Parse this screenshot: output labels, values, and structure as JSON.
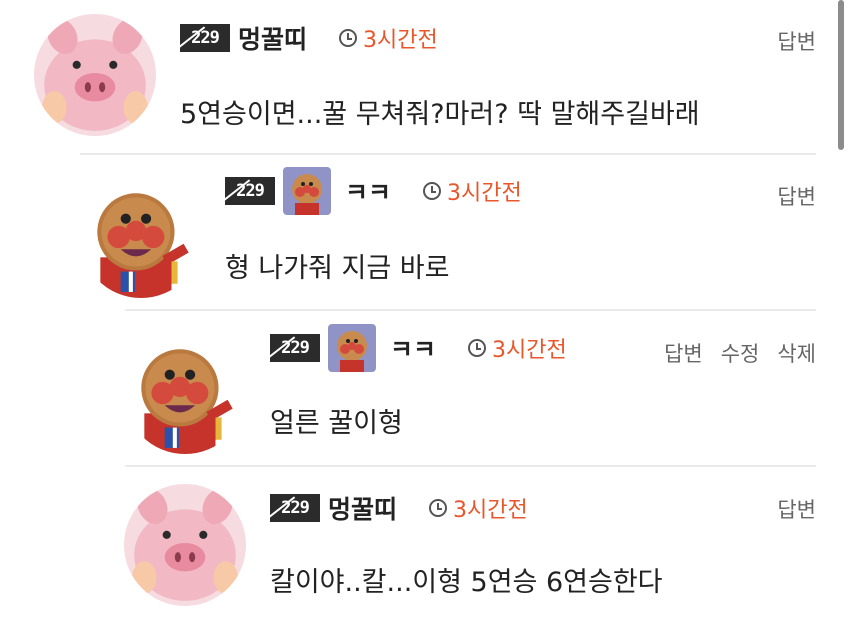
{
  "level_label": "229",
  "comments": [
    {
      "nickname": "멍꿀띠",
      "time": "3시간전",
      "text": "5연승이면...꿀 무쳐줘?마러? 딱 말해주길바래",
      "actions": [
        "답변"
      ]
    },
    {
      "nickname": "ㅋㅋ",
      "time": "3시간전",
      "text": "형 나가줘 지금 바로",
      "actions": [
        "답변"
      ]
    },
    {
      "nickname": "ㅋㅋ",
      "time": "3시간전",
      "text": "얼른 꿀이형",
      "actions": [
        "답변",
        "수정",
        "삭제"
      ]
    },
    {
      "nickname": "멍꿀띠",
      "time": "3시간전",
      "text": "칼이야..칼...이형 5연승 6연승한다",
      "actions": [
        "답변"
      ]
    }
  ],
  "colors": {
    "time": "#e8562a",
    "divider": "#ebebeb",
    "action": "#666666"
  },
  "icons": [
    "clock-icon",
    "level-badge",
    "pig-avatar",
    "anpanman-avatar"
  ]
}
